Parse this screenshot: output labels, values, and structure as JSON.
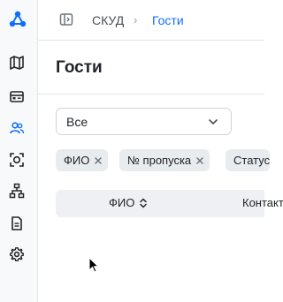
{
  "sidebar": {
    "items": [
      {
        "icon": "map-icon"
      },
      {
        "icon": "id-card-icon"
      },
      {
        "icon": "users-icon",
        "active": true
      },
      {
        "icon": "scan-face-icon"
      },
      {
        "icon": "network-icon"
      },
      {
        "icon": "document-icon"
      },
      {
        "icon": "settings-icon"
      }
    ]
  },
  "header": {
    "breadcrumb_root": "СКУД",
    "breadcrumb_separator": "›",
    "breadcrumb_current": "Гости"
  },
  "page": {
    "title": "Гости"
  },
  "filter": {
    "selected": "Все"
  },
  "chips": [
    {
      "label": "ФИО"
    },
    {
      "label": "№ пропуска"
    },
    {
      "label": "Статус"
    }
  ],
  "table": {
    "columns": [
      {
        "label": "ФИО"
      },
      {
        "label": "Контакты"
      }
    ]
  },
  "colors": {
    "accent": "#0d6efd",
    "sidebar_bg": "#f8f9fa",
    "chip_bg": "#e9ecef",
    "table_header_bg": "#eef0f3"
  }
}
